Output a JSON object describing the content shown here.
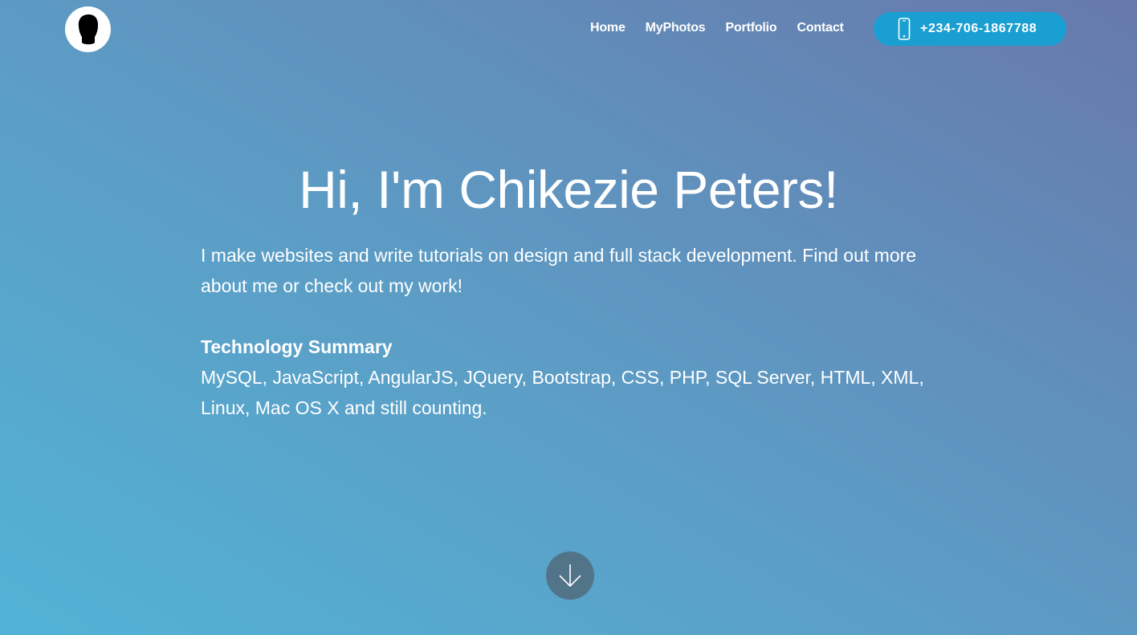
{
  "header": {
    "nav_items": [
      {
        "label": "Home"
      },
      {
        "label": "MyPhotos"
      },
      {
        "label": "Portfolio"
      },
      {
        "label": "Contact"
      }
    ],
    "phone_button": {
      "label": "+234-706-1867788",
      "icon": "mobile-phone-icon"
    }
  },
  "hero": {
    "title": "Hi, I'm Chikezie Peters!",
    "intro": "I make websites and write tutorials on design and full stack development. Find out more about me or check out my work!",
    "tech_heading": "Technology Summary",
    "tech_list": "MySQL, JavaScript, AngularJS, JQuery, Bootstrap, CSS, PHP, SQL Server, HTML, XML, Linux, Mac OS X and still counting."
  },
  "icons": {
    "logo": "avatar-silhouette-icon",
    "scroll": "arrow-down-icon"
  },
  "colors": {
    "gradient_start": "#52b3d6",
    "gradient_end": "#6779ac",
    "phone_button": "#1a9fd2",
    "text": "#ffffff"
  }
}
